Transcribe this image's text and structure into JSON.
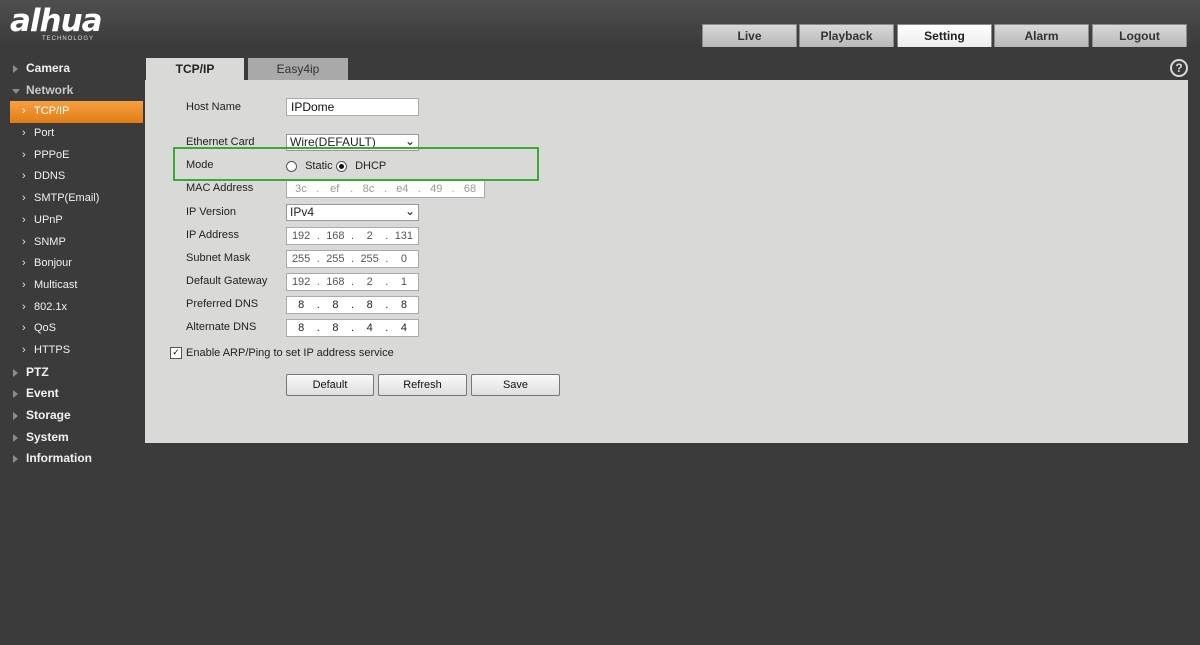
{
  "header": {
    "logo": "alhua",
    "logo_sub": "TECHNOLOGY",
    "nav": [
      {
        "label": "Live"
      },
      {
        "label": "Playback"
      },
      {
        "label": "Setting"
      },
      {
        "label": "Alarm"
      },
      {
        "label": "Logout"
      }
    ],
    "active_nav": "Setting"
  },
  "sidebar": {
    "camera": "Camera",
    "network": "Network",
    "network_items": [
      "TCP/IP",
      "Port",
      "PPPoE",
      "DDNS",
      "SMTP(Email)",
      "UPnP",
      "SNMP",
      "Bonjour",
      "Multicast",
      "802.1x",
      "QoS",
      "HTTPS"
    ],
    "active_item": "TCP/IP",
    "ptz": "PTZ",
    "event": "Event",
    "storage": "Storage",
    "system": "System",
    "information": "Information"
  },
  "tabs": {
    "tcpip": "TCP/IP",
    "easy4ip": "Easy4ip",
    "help": "?"
  },
  "form": {
    "host_name": {
      "label": "Host Name",
      "value": "IPDome"
    },
    "ethernet_card": {
      "label": "Ethernet Card",
      "value": "Wire(DEFAULT)"
    },
    "mode": {
      "label": "Mode",
      "static": "Static",
      "dhcp": "DHCP",
      "selected": "DHCP"
    },
    "mac": {
      "label": "MAC Address",
      "octets": [
        "3c",
        "ef",
        "8c",
        "e4",
        "49",
        "68"
      ]
    },
    "ip_version": {
      "label": "IP Version",
      "value": "IPv4"
    },
    "ip_address": {
      "label": "IP Address",
      "octets": [
        "192",
        "168",
        "2",
        "131"
      ]
    },
    "subnet_mask": {
      "label": "Subnet Mask",
      "octets": [
        "255",
        "255",
        "255",
        "0"
      ]
    },
    "gateway": {
      "label": "Default Gateway",
      "octets": [
        "192",
        "168",
        "2",
        "1"
      ]
    },
    "preferred_dns": {
      "label": "Preferred DNS",
      "octets": [
        "8",
        "8",
        "8",
        "8"
      ]
    },
    "alternate_dns": {
      "label": "Alternate DNS",
      "octets": [
        "8",
        "8",
        "4",
        "4"
      ]
    },
    "arp_ping": {
      "label": "Enable ARP/Ping to set IP address service",
      "checked": true
    },
    "buttons": {
      "default": "Default",
      "refresh": "Refresh",
      "save": "Save"
    }
  },
  "colors": {
    "accent": "#f08c2a",
    "highlight": "#3aaa35",
    "panel": "#d9d9d8"
  }
}
